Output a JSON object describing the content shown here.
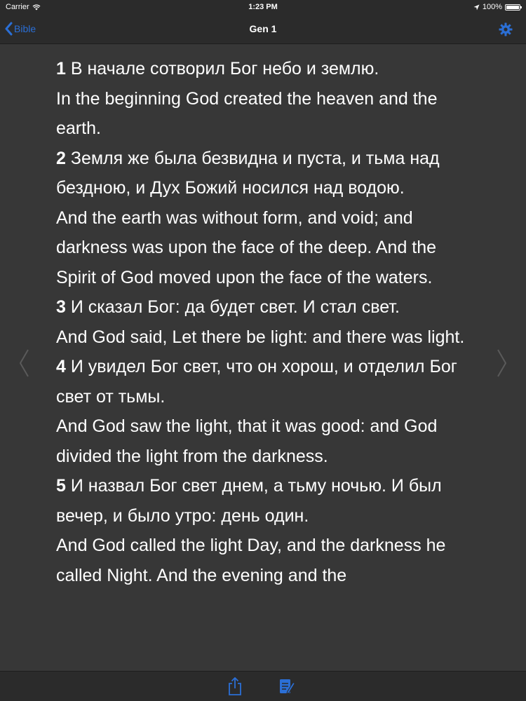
{
  "status_bar": {
    "carrier": "Carrier",
    "time": "1:23 PM",
    "battery": "100%",
    "battery_level": 1.0
  },
  "nav_bar": {
    "back_label": "Bible",
    "title": "Gen 1",
    "settings_icon": "gear-icon"
  },
  "verses": [
    {
      "number": "1",
      "ru": "В начале сотворил Бог небо и землю.",
      "en": "In the beginning God created the heaven and the earth."
    },
    {
      "number": "2",
      "ru": "Земля же была безвидна и пуста, и тьма над бездною, и Дух Божий носился над водою.",
      "en": "And the earth was without form, and void; and darkness was upon the face of the deep. And the Spirit of God moved upon the face of the waters."
    },
    {
      "number": "3",
      "ru": "И сказал Бог: да будет свет. И стал свет.",
      "en": "And God said, Let there be light: and there was light."
    },
    {
      "number": "4",
      "ru": "И увидел Бог свет, что он хорош, и отделил Бог свет от тьмы.",
      "en": "And God saw the light, that it was good: and God divided the light from the darkness."
    },
    {
      "number": "5",
      "ru": "И назвал Бог свет днем, а тьму ночью. И был вечер, и было утро: день один.",
      "en": "And God called the light Day, and the darkness he called Night. And the evening and the"
    }
  ],
  "colors": {
    "accent": "#2b6fd6",
    "background": "#373737",
    "bar": "#2b2b2b",
    "text": "#ffffff",
    "arrow": "#5a5a5a"
  },
  "toolbar": {
    "share_icon": "share-icon",
    "notes_icon": "notes-icon"
  }
}
